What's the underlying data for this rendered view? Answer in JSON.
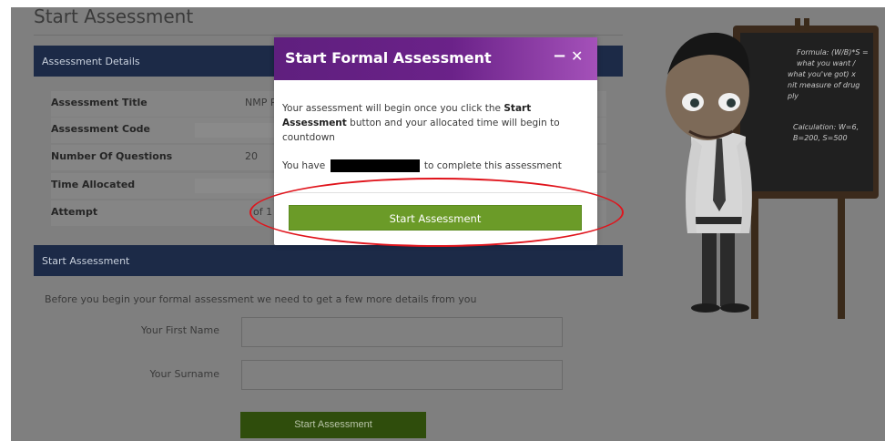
{
  "page": {
    "title": "Start Assessment"
  },
  "details_panel": {
    "header": "Assessment Details",
    "rows": [
      {
        "label": "Assessment Title",
        "value": "NMP P"
      },
      {
        "label": "Assessment Code",
        "value": ""
      },
      {
        "label": "Number Of Questions",
        "value": "20"
      },
      {
        "label": "Time Allocated",
        "value": ""
      },
      {
        "label": "Attempt",
        "value": "of 1"
      }
    ]
  },
  "start_panel": {
    "header": "Start Assessment",
    "intro": "Before you begin your formal assessment we need to get a few more details from you",
    "first_name_label": "Your First Name",
    "surname_label": "Your Surname",
    "button_label": "Start Assessment"
  },
  "modal": {
    "title": "Start Formal Assessment",
    "minimize": "−",
    "close": "✕",
    "text_before": "Your assessment will begin once you click the ",
    "text_bold": "Start Assessment",
    "text_after": " button and your allocated time will begin to countdown",
    "have_prefix": "You have",
    "have_suffix": "to complete this assessment",
    "button_label": "Start Assessment"
  },
  "blackboard": {
    "lines": [
      "Formula: (W/B)*S =",
      "what you want /",
      "what you've got) x",
      "nit measure of drug",
      "ply",
      "Calculation: W=6,",
      "B=200, S=500"
    ]
  },
  "colors": {
    "modal_header": "#6b2289",
    "modal_button": "#6b9b28",
    "annotation": "#e0141c"
  }
}
